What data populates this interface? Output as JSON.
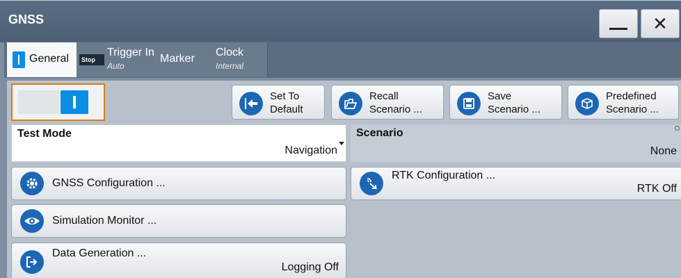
{
  "window": {
    "title": "GNSS",
    "minimize_label": "—",
    "close_label": "✕"
  },
  "tabs": [
    {
      "label": "General",
      "sub": ""
    },
    {
      "label": "Trigger In",
      "sub": "Auto",
      "badge": "Stop"
    },
    {
      "label": "Marker",
      "sub": ""
    },
    {
      "label": "Clock",
      "sub": "Internal"
    }
  ],
  "toolbar": {
    "set_default": [
      "Set To",
      "Default"
    ],
    "recall": [
      "Recall",
      "Scenario ..."
    ],
    "save": [
      "Save",
      "Scenario ..."
    ],
    "predefined": [
      "Predefined",
      "Scenario ..."
    ]
  },
  "test_mode": {
    "label": "Test Mode",
    "value": "Navigation"
  },
  "scenario": {
    "label": "Scenario",
    "value": "None"
  },
  "buttons": {
    "gnss_config": "GNSS Configuration ...",
    "rtk_config": {
      "label": "RTK Configuration ...",
      "value": "RTK Off"
    },
    "sim_monitor": "Simulation Monitor ...",
    "data_gen": {
      "label": "Data Generation ...",
      "value": "Logging Off"
    }
  },
  "colors": {
    "accent": "#0b8de4",
    "icon": "#1d66b3",
    "focus": "#e07a10",
    "title_bar": "#4e6076"
  }
}
